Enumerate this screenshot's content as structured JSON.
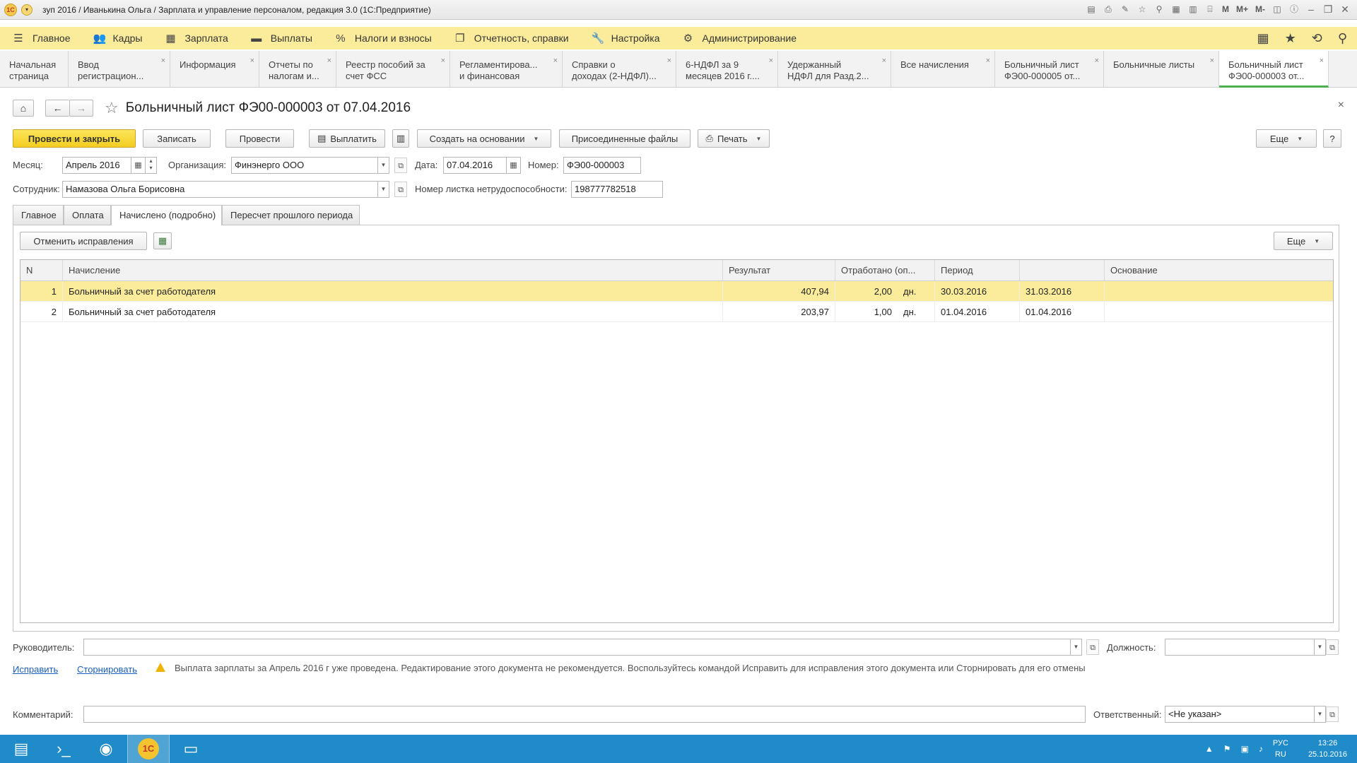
{
  "titlebar": {
    "title": "зуп 2016 / Иванькина Ольга / Зарплата и управление персоналом, редакция 3.0  (1С:Предприятие)",
    "m1": "M",
    "m2": "M+",
    "m3": "M-"
  },
  "menu": {
    "items": [
      {
        "label": "Главное",
        "icon": "☰"
      },
      {
        "label": "Кадры",
        "icon": "👥"
      },
      {
        "label": "Зарплата",
        "icon": "▦"
      },
      {
        "label": "Выплаты",
        "icon": "▬"
      },
      {
        "label": "Налоги и взносы",
        "icon": "%"
      },
      {
        "label": "Отчетность, справки",
        "icon": "❐"
      },
      {
        "label": "Настройка",
        "icon": "🔧"
      },
      {
        "label": "Администрирование",
        "icon": "⚙"
      }
    ]
  },
  "wintabs": [
    {
      "l1": "Начальная",
      "l2": "страница",
      "w": 97,
      "close": ""
    },
    {
      "l1": "Ввод",
      "l2": "регистрацион...",
      "w": 144,
      "close": "×"
    },
    {
      "l1": "Информация",
      "l2": "",
      "w": 126,
      "close": "×"
    },
    {
      "l1": "Отчеты по",
      "l2": "налогам и...",
      "w": 109,
      "close": "×"
    },
    {
      "l1": "Реестр пособий за",
      "l2": "счет ФСС",
      "w": 161,
      "close": "×"
    },
    {
      "l1": "Регламентирова...",
      "l2": "и финансовая",
      "w": 159,
      "close": "×"
    },
    {
      "l1": "Справки о",
      "l2": "доходах (2-НДФЛ)...",
      "w": 161,
      "close": "×"
    },
    {
      "l1": "6-НДФЛ за 9",
      "l2": "месяцев 2016 г....",
      "w": 144,
      "close": "×"
    },
    {
      "l1": "Удержанный",
      "l2": "НДФЛ для Разд.2...",
      "w": 160,
      "close": "×"
    },
    {
      "l1": "Все начисления",
      "l2": "",
      "w": 147,
      "close": "×"
    },
    {
      "l1": "Больничный лист",
      "l2": "ФЭ00-000005 от...",
      "w": 154,
      "close": "×"
    },
    {
      "l1": "Больничные листы",
      "l2": "",
      "w": 163,
      "close": "×"
    },
    {
      "l1": "Больничный лист",
      "l2": "ФЭ00-000003 от...",
      "w": 155,
      "close": "×"
    }
  ],
  "doc": {
    "title": "Больничный лист ФЭ00-000003 от 07.04.2016",
    "close": "×"
  },
  "toolbar": {
    "post_close": "Провести и закрыть",
    "write": "Записать",
    "post": "Провести",
    "pay": "Выплатить",
    "create_based": "Создать на основании",
    "attached": "Присоединенные файлы",
    "print": "Печать",
    "more": "Еще",
    "help": "?"
  },
  "fields": {
    "month_label": "Месяц:",
    "month": "Апрель 2016",
    "org_label": "Организация:",
    "org": "Финэнерго ООО",
    "date_label": "Дата:",
    "date": "07.04.2016",
    "number_label": "Номер:",
    "number": "ФЭ00-000003",
    "employee_label": "Сотрудник:",
    "employee": "Намазова Ольга Борисовна",
    "sick_no_label": "Номер листка нетрудоспособности:",
    "sick_no": "198777782518"
  },
  "formtabs": [
    "Главное",
    "Оплата",
    "Начислено (подробно)",
    "Пересчет прошлого периода"
  ],
  "pane": {
    "cancel_fix": "Отменить исправления",
    "more": "Еще"
  },
  "table": {
    "headers": [
      "N",
      "Начисление",
      "Результат",
      "Отработано (оп...",
      "Период",
      "",
      "Основание"
    ],
    "rows": [
      {
        "n": "1",
        "accrual": "Больничный за счет работодателя",
        "result": "407,94",
        "worked": "2,00",
        "unit": "дн.",
        "from": "30.03.2016",
        "to": "31.03.2016",
        "basis": ""
      },
      {
        "n": "2",
        "accrual": "Больничный за счет работодателя",
        "result": "203,97",
        "worked": "1,00",
        "unit": "дн.",
        "from": "01.04.2016",
        "to": "01.04.2016",
        "basis": ""
      }
    ]
  },
  "bottom": {
    "manager_label": "Руководитель:",
    "manager": "",
    "position_label": "Должность:",
    "position": "",
    "fix_link": "Исправить",
    "storno_link": "Сторнировать",
    "warning": "Выплата зарплаты за Апрель 2016 г уже проведена. Редактирование этого документа не рекомендуется. Воспользуйтесь командой Исправить для исправления этого документа или Сторнировать для его отмены",
    "comment_label": "Комментарий:",
    "comment": "",
    "responsible_label": "Ответственный:",
    "responsible": "<Не указан>"
  },
  "tray": {
    "lang1": "РУС",
    "lang2": "RU",
    "time": "13:26",
    "date": "25.10.2016"
  }
}
